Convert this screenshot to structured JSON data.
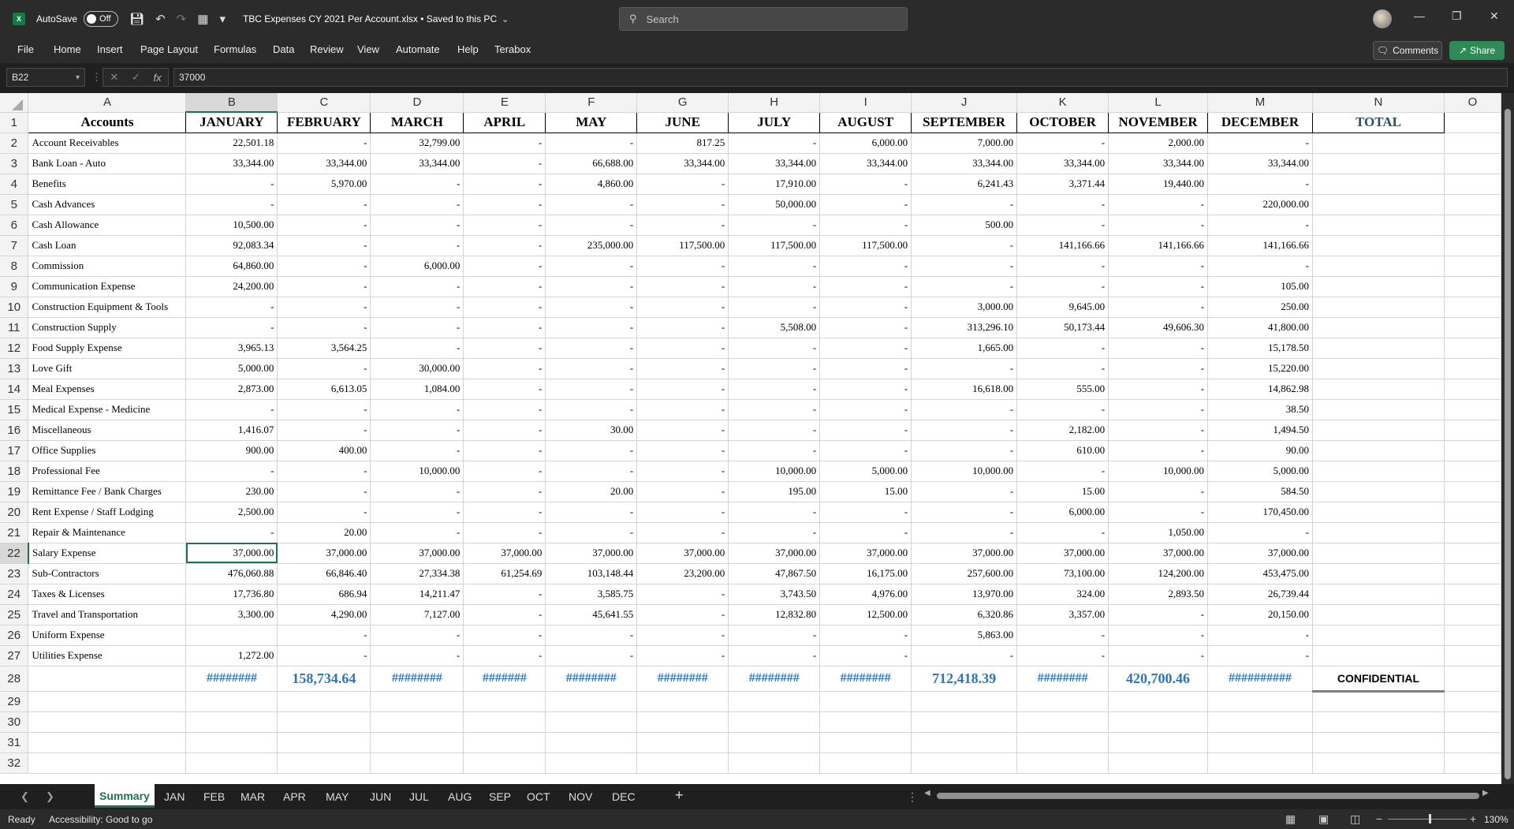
{
  "titlebar": {
    "app_icon": "X",
    "autosave_label": "AutoSave",
    "autosave_state": "Off",
    "file_title": "TBC Expenses CY 2021 Per Account.xlsx • Saved to this PC",
    "search_placeholder": "Search",
    "icons": [
      "save-icon",
      "undo-icon",
      "redo-icon",
      "print-preview-icon",
      "customize-qat-icon"
    ]
  },
  "ribbon": {
    "tabs": [
      "File",
      "Home",
      "Insert",
      "Page Layout",
      "Formulas",
      "Data",
      "Review",
      "View",
      "Automate",
      "Help",
      "Terabox"
    ],
    "comments_label": "Comments",
    "share_label": "Share"
  },
  "formula_bar": {
    "name_box": "B22",
    "formula": "37000"
  },
  "columns": [
    "A",
    "B",
    "C",
    "D",
    "E",
    "F",
    "G",
    "H",
    "I",
    "J",
    "K",
    "L",
    "M",
    "N",
    "O"
  ],
  "selected_column": "B",
  "selected_row": 22,
  "header_row": [
    "Accounts",
    "JANUARY",
    "FEBRUARY",
    "MARCH",
    "APRIL",
    "MAY",
    "JUNE",
    "JULY",
    "AUGUST",
    "SEPTEMBER",
    "OCTOBER",
    "NOVEMBER",
    "DECEMBER",
    "TOTAL"
  ],
  "rows": [
    {
      "n": "2",
      "cells": [
        "Account Receivables",
        "22,501.18",
        "-",
        "32,799.00",
        "-",
        "-",
        "817.25",
        "-",
        "6,000.00",
        "7,000.00",
        "-",
        "2,000.00",
        "-"
      ]
    },
    {
      "n": "3",
      "cells": [
        "Bank Loan - Auto",
        "33,344.00",
        "33,344.00",
        "33,344.00",
        "-",
        "66,688.00",
        "33,344.00",
        "33,344.00",
        "33,344.00",
        "33,344.00",
        "33,344.00",
        "33,344.00",
        "33,344.00"
      ]
    },
    {
      "n": "4",
      "cells": [
        "Benefits",
        "-",
        "5,970.00",
        "-",
        "-",
        "4,860.00",
        "-",
        "17,910.00",
        "-",
        "6,241.43",
        "3,371.44",
        "19,440.00",
        "-"
      ]
    },
    {
      "n": "5",
      "cells": [
        "Cash Advances",
        "-",
        "-",
        "-",
        "-",
        "-",
        "-",
        "50,000.00",
        "-",
        "-",
        "-",
        "-",
        "220,000.00"
      ]
    },
    {
      "n": "6",
      "cells": [
        "Cash Allowance",
        "10,500.00",
        "-",
        "-",
        "-",
        "-",
        "-",
        "-",
        "-",
        "500.00",
        "-",
        "-",
        "-"
      ]
    },
    {
      "n": "7",
      "cells": [
        "Cash Loan",
        "92,083.34",
        "-",
        "-",
        "-",
        "235,000.00",
        "117,500.00",
        "117,500.00",
        "117,500.00",
        "-",
        "141,166.66",
        "141,166.66",
        "141,166.66"
      ]
    },
    {
      "n": "8",
      "cells": [
        "Commission",
        "64,860.00",
        "-",
        "6,000.00",
        "-",
        "-",
        "-",
        "-",
        "-",
        "-",
        "-",
        "-",
        "-"
      ]
    },
    {
      "n": "9",
      "cells": [
        "Communication Expense",
        "24,200.00",
        "-",
        "-",
        "-",
        "-",
        "-",
        "-",
        "-",
        "-",
        "-",
        "-",
        "105.00"
      ]
    },
    {
      "n": "10",
      "cells": [
        "Construction Equipment & Tools",
        "-",
        "-",
        "-",
        "-",
        "-",
        "-",
        "-",
        "-",
        "3,000.00",
        "9,645.00",
        "-",
        "250.00"
      ]
    },
    {
      "n": "11",
      "cells": [
        "Construction Supply",
        "-",
        "-",
        "-",
        "-",
        "-",
        "-",
        "5,508.00",
        "-",
        "313,296.10",
        "50,173.44",
        "49,606.30",
        "41,800.00"
      ]
    },
    {
      "n": "12",
      "cells": [
        "Food Supply Expense",
        "3,965.13",
        "3,564.25",
        "-",
        "-",
        "-",
        "-",
        "-",
        "-",
        "1,665.00",
        "-",
        "-",
        "15,178.50"
      ]
    },
    {
      "n": "13",
      "cells": [
        "Love Gift",
        "5,000.00",
        "-",
        "30,000.00",
        "-",
        "-",
        "-",
        "-",
        "-",
        "-",
        "-",
        "-",
        "15,220.00"
      ]
    },
    {
      "n": "14",
      "cells": [
        "Meal Expenses",
        "2,873.00",
        "6,613.05",
        "1,084.00",
        "-",
        "-",
        "-",
        "-",
        "-",
        "16,618.00",
        "555.00",
        "-",
        "14,862.98"
      ]
    },
    {
      "n": "15",
      "cells": [
        "Medical Expense - Medicine",
        "-",
        "-",
        "-",
        "-",
        "-",
        "-",
        "-",
        "-",
        "-",
        "-",
        "-",
        "38.50"
      ]
    },
    {
      "n": "16",
      "cells": [
        "Miscellaneous",
        "1,416.07",
        "-",
        "-",
        "-",
        "30.00",
        "-",
        "-",
        "-",
        "-",
        "2,182.00",
        "-",
        "1,494.50"
      ]
    },
    {
      "n": "17",
      "cells": [
        "Office Supplies",
        "900.00",
        "400.00",
        "-",
        "-",
        "-",
        "-",
        "-",
        "-",
        "-",
        "610.00",
        "-",
        "90.00"
      ]
    },
    {
      "n": "18",
      "cells": [
        "Professional Fee",
        "-",
        "-",
        "10,000.00",
        "-",
        "-",
        "-",
        "10,000.00",
        "5,000.00",
        "10,000.00",
        "-",
        "10,000.00",
        "5,000.00"
      ]
    },
    {
      "n": "19",
      "cells": [
        "Remittance Fee / Bank Charges",
        "230.00",
        "-",
        "-",
        "-",
        "20.00",
        "-",
        "195.00",
        "15.00",
        "-",
        "15.00",
        "-",
        "584.50"
      ]
    },
    {
      "n": "20",
      "cells": [
        "Rent Expense / Staff Lodging",
        "2,500.00",
        "-",
        "-",
        "-",
        "-",
        "-",
        "-",
        "-",
        "-",
        "6,000.00",
        "-",
        "170,450.00"
      ]
    },
    {
      "n": "21",
      "cells": [
        "Repair & Maintenance",
        "-",
        "20.00",
        "-",
        "-",
        "-",
        "-",
        "-",
        "-",
        "-",
        "-",
        "1,050.00",
        "-"
      ]
    },
    {
      "n": "22",
      "cells": [
        "Salary Expense",
        "37,000.00",
        "37,000.00",
        "37,000.00",
        "37,000.00",
        "37,000.00",
        "37,000.00",
        "37,000.00",
        "37,000.00",
        "37,000.00",
        "37,000.00",
        "37,000.00",
        "37,000.00"
      ]
    },
    {
      "n": "23",
      "cells": [
        "Sub-Contractors",
        "476,060.88",
        "66,846.40",
        "27,334.38",
        "61,254.69",
        "103,148.44",
        "23,200.00",
        "47,867.50",
        "16,175.00",
        "257,600.00",
        "73,100.00",
        "124,200.00",
        "453,475.00"
      ]
    },
    {
      "n": "24",
      "cells": [
        "Taxes & Licenses",
        "17,736.80",
        "686.94",
        "14,211.47",
        "-",
        "3,585.75",
        "-",
        "3,743.50",
        "4,976.00",
        "13,970.00",
        "324.00",
        "2,893.50",
        "26,739.44"
      ]
    },
    {
      "n": "25",
      "cells": [
        "Travel and Transportation",
        "3,300.00",
        "4,290.00",
        "7,127.00",
        "-",
        "45,641.55",
        "-",
        "12,832.80",
        "12,500.00",
        "6,320.86",
        "3,357.00",
        "-",
        "20,150.00"
      ]
    },
    {
      "n": "26",
      "cells": [
        "Uniform Expense",
        "",
        "-",
        "-",
        "-",
        "-",
        "-",
        "-",
        "-",
        "5,863.00",
        "-",
        "-",
        "-"
      ]
    },
    {
      "n": "27",
      "cells": [
        "Utilities Expense",
        "1,272.00",
        "-",
        "-",
        "-",
        "-",
        "-",
        "-",
        "-",
        "-",
        "-",
        "-",
        "-"
      ]
    }
  ],
  "totals_row": [
    "########",
    "158,734.64",
    "########",
    "#######",
    "########",
    "########",
    "########",
    "########",
    "712,418.39",
    "########",
    "420,700.46",
    "##########"
  ],
  "confidential_label": "CONFIDENTIAL",
  "empty_rows": [
    "29",
    "30",
    "31",
    "32"
  ],
  "sheet_tabs": [
    "Summary",
    "JAN",
    "FEB",
    "MAR",
    "APR",
    "MAY",
    "JUN",
    "JUL",
    "AUG",
    "SEP",
    "OCT",
    "NOV",
    "DEC"
  ],
  "active_sheet": "Summary",
  "add_sheet": "+",
  "status": {
    "ready": "Ready",
    "accessibility": "Accessibility: Good to go",
    "zoom": "130%"
  },
  "colors": {
    "excel_green": "#217346",
    "total_blue": "#2e75b6",
    "header_total": "#1f4e79"
  }
}
